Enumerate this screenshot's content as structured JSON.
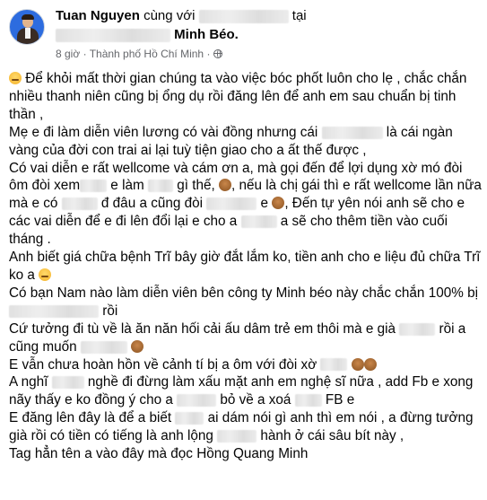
{
  "header": {
    "author": "Tuan Nguyen",
    "with_text": "cùng với",
    "at_text": "tại",
    "place": "Minh Béo.",
    "time": "8 giờ",
    "separator": "·",
    "location": "Thành phố Hồ Chí Minh",
    "separator2": "·"
  },
  "post": {
    "p1a": " Để khỏi mất thời gian chúng ta vào việc bóc phốt luôn cho lẹ , chắc chắn nhiều thanh niên cũng bị ổng dụ rồi đăng lên để anh em sau chuẩn bị tinh thần ,",
    "p2a": "Mẹ e đi làm diễn viên lương có vài đồng nhưng cái ",
    "p2b": " là cái ngàn vàng của đời con trai ai lại tuỳ tiện giao cho a ất thế được ,",
    "p3a": "Có vai diễn e rất wellcome và cám ơn a, mà gọi đến để lợi dụng xờ mó đòi ôm đòi xem",
    "p3b": " e làm ",
    "p3c": " gì thế, ",
    "p3d": ", nếu là chị gái thì e rất wellcome lần nữa mà e có ",
    "p3e": " đ đâu a cũng đòi ",
    "p3f": " e ",
    "p3g": ", Đến tự yên nói anh sẽ cho e các vai diễn để e đi lên đổi lại e cho a ",
    "p3h": " a sẽ cho thêm tiền vào cuối tháng .",
    "p4a": "Anh biết giá chữa bệnh Trĩ bây giờ đắt lắm ko, tiền anh cho e liệu đủ chữa Trĩ ko a ",
    "p5a": "Có bạn Nam nào làm diễn viên bên công ty Minh béo này chắc chắn 100% bị ",
    "p5b": " rồi",
    "p6a": "Cứ tưởng đi tù về là ăn năn hối cải ấu dâm trẻ em thôi mà e già ",
    "p6b": " rồi a cũng muốn ",
    "p7a": "E vẫn chưa hoàn hồn về cảnh tí bị a ôm với đòi xờ ",
    "p8a": "A nghĩ ",
    "p8b": " nghề đi đừng làm xấu mặt anh em nghệ sĩ nữa , add Fb e xong nãy thấy e ko đồng ý cho a ",
    "p8c": " bỏ về a xoá ",
    "p8d": " FB e",
    "p9a": "E đăng lên đây là để a biết ",
    "p9b": " ai dám nói gì anh thì em nói , a đừng tưởng già rồi có tiền có tiếng là anh lộng ",
    "p9c": " hành ở cái sâu bít này ,",
    "p10a": "Tag hẳn tên a vào đây mà đọc Hồng Quang Minh"
  }
}
